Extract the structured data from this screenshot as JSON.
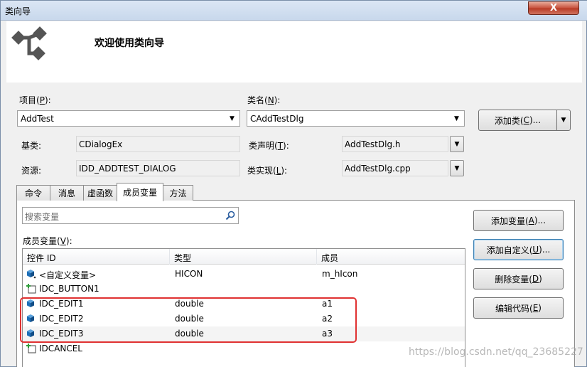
{
  "window": {
    "title": "类向导",
    "close_label": "X"
  },
  "banner": {
    "title": "欢迎使用类向导"
  },
  "project": {
    "label": "项目(",
    "key": "P",
    "label_end": "):",
    "value": "AddTest"
  },
  "class_name": {
    "label": "类名(",
    "key": "N",
    "label_end": "):",
    "value": "CAddTestDlg"
  },
  "add_class": {
    "label": "添加类(",
    "key": "C",
    "label_end": ")..."
  },
  "base_class": {
    "label": "基类:",
    "value": "CDialogEx"
  },
  "class_decl": {
    "label": "类声明(",
    "key": "T",
    "label_end": "):",
    "value": "AddTestDlg.h"
  },
  "resource": {
    "label": "资源:",
    "value": "IDD_ADDTEST_DIALOG"
  },
  "class_impl": {
    "label": "类实现(",
    "key": "L",
    "label_end": "):",
    "value": "AddTestDlg.cpp"
  },
  "tabs": [
    {
      "label": "命令"
    },
    {
      "label": "消息"
    },
    {
      "label": "虚函数"
    },
    {
      "label": "成员变量"
    },
    {
      "label": "方法"
    }
  ],
  "search": {
    "placeholder": "搜索变量"
  },
  "member_vars": {
    "label": "成员变量(",
    "key": "V",
    "label_end": "):"
  },
  "columns": [
    "控件 ID",
    "类型",
    "成员"
  ],
  "rows": [
    {
      "id": "<自定义变量>",
      "type": "HICON",
      "member": "m_hIcon",
      "icon": "cube-icon"
    },
    {
      "id": "IDC_BUTTON1",
      "type": "",
      "member": "",
      "icon": "control-icon"
    },
    {
      "id": "IDC_EDIT1",
      "type": "double",
      "member": "a1",
      "icon": "cube-icon"
    },
    {
      "id": "IDC_EDIT2",
      "type": "double",
      "member": "a2",
      "icon": "cube-icon"
    },
    {
      "id": "IDC_EDIT3",
      "type": "double",
      "member": "a3",
      "icon": "cube-icon"
    },
    {
      "id": "IDCANCEL",
      "type": "",
      "member": "",
      "icon": "control-icon"
    }
  ],
  "buttons": {
    "add_var": {
      "label": "添加变量(",
      "key": "A",
      "label_end": ")..."
    },
    "add_custom": {
      "label": "添加自定义(",
      "key": "U",
      "label_end": ")..."
    },
    "delete_var": {
      "label": "删除变量(",
      "key": "D",
      "label_end": ")"
    },
    "edit_code": {
      "label": "编辑代码(",
      "key": "E",
      "label_end": ")"
    }
  },
  "watermark": "https://blog.csdn.net/qq_23685227",
  "colors": {
    "highlight": "#e03131",
    "cube": "#1d6fb8"
  }
}
